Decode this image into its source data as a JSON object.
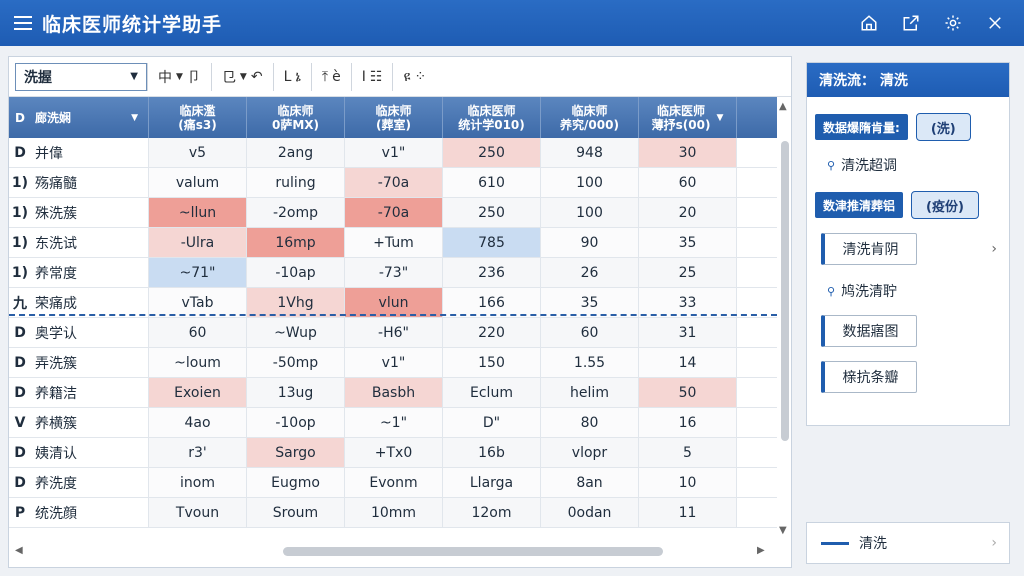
{
  "app": {
    "title": "临床医师统计学助手"
  },
  "toolbar": {
    "select_value": "洗握",
    "tools": [
      "中",
      "卩",
      "㔾",
      "↶",
      "L",
      "ኔ",
      "⤒",
      "ѐ",
      "I",
      "☷",
      "ዩ",
      "⁘"
    ]
  },
  "grid": {
    "header": {
      "id": "D",
      "name": "廊洗娴",
      "cols": [
        [
          "临床濫",
          "(痛s3)"
        ],
        [
          "临床师",
          "0萨MX)"
        ],
        [
          "临床师",
          "(葬室)"
        ],
        [
          "临床医师",
          "统计学010)"
        ],
        [
          "临床师",
          "养究/000)"
        ],
        [
          "临床医师",
          "薄抒s(00)"
        ]
      ]
    },
    "rows": [
      {
        "id": "D",
        "name": "并偉",
        "vals": [
          "v5",
          "2ang",
          "v1\"",
          "250",
          "948",
          "30"
        ],
        "tone": [
          "",
          "",
          "",
          "pink",
          "",
          "pink"
        ]
      },
      {
        "id": "1)",
        "name": "殇痛髓",
        "vals": [
          "valum",
          "ruling",
          "-70a",
          "610",
          "100",
          "60"
        ],
        "tone": [
          "",
          "",
          "pink",
          "",
          "",
          ""
        ]
      },
      {
        "id": "1)",
        "name": "殊洗蔟",
        "vals": [
          "~llun",
          "-2omp",
          "-70a",
          "250",
          "100",
          "20"
        ],
        "tone": [
          "red",
          "",
          "red",
          "",
          "",
          ""
        ]
      },
      {
        "id": "1)",
        "name": "东洗试",
        "vals": [
          "-Ulra",
          "16mp",
          "+Tum",
          "785",
          "90",
          "35"
        ],
        "tone": [
          "pink",
          "red",
          "",
          "blue",
          "",
          ""
        ]
      },
      {
        "id": "1)",
        "name": "养常度",
        "vals": [
          "~71\"",
          "-10ap",
          "-73\"",
          "236",
          "26",
          "25"
        ],
        "tone": [
          "blue",
          "",
          "",
          "",
          "",
          ""
        ]
      },
      {
        "id": "九",
        "name": "荣痛成",
        "vals": [
          "vTab",
          "1Vhg",
          "vlun",
          "166",
          "35",
          "33"
        ],
        "tone": [
          "",
          "pink",
          "red",
          "",
          "",
          ""
        ]
      },
      {
        "id": "D",
        "name": "奥学认",
        "vals": [
          "60",
          "~Wup",
          "-H6\"",
          "220",
          "60",
          "31"
        ],
        "tone": [
          "",
          "",
          "",
          "",
          "",
          ""
        ]
      },
      {
        "id": "D",
        "name": "弄洗簇",
        "vals": [
          "~loum",
          "-50mp",
          "v1\"",
          "150",
          "1.55",
          "14"
        ],
        "tone": [
          "",
          "",
          "",
          "",
          "",
          ""
        ]
      },
      {
        "id": "D",
        "name": "养籍洁",
        "vals": [
          "Exoien",
          "13ug",
          "Basbh",
          "Eclum",
          "helim",
          "50"
        ],
        "tone": [
          "pink",
          "",
          "pink",
          "",
          "",
          "pink"
        ]
      },
      {
        "id": "V",
        "name": "养横簇",
        "vals": [
          "4ao",
          "-10op",
          "~1\"",
          "D\"",
          "80",
          "16"
        ],
        "tone": [
          "",
          "",
          "",
          "",
          "",
          ""
        ]
      },
      {
        "id": "D",
        "name": "姨清认",
        "vals": [
          "r3'",
          "Sargo",
          "+Tx0",
          "16b",
          "vlopr",
          "5"
        ],
        "tone": [
          "",
          "pink",
          "",
          "",
          "",
          ""
        ]
      },
      {
        "id": "D",
        "name": "养洗度",
        "vals": [
          "inom",
          "Eugmo",
          "Evonm",
          "Llarga",
          "8an",
          "10"
        ],
        "tone": [
          "",
          "",
          "",
          "",
          "",
          ""
        ]
      },
      {
        "id": "P",
        "name": "统洗顔",
        "vals": [
          "Tvoun",
          "Sroum",
          "10mm",
          "12om",
          "0odan",
          "11"
        ],
        "tone": [
          "",
          "",
          "",
          "",
          "",
          ""
        ]
      }
    ]
  },
  "panel": {
    "title": "清洗流： 清洗",
    "label1": "数据爆隋肯量:",
    "pill1": "(洗)",
    "link1": "清洗超调",
    "label2": "数津推清葬铝",
    "pill2": "(疫份)",
    "btn1": "清洗肯阴",
    "link2": "鸠洗清聍",
    "btn2": "数据寤图",
    "btn3": "榇抗条瓣"
  },
  "legend": {
    "label": "清洗"
  }
}
